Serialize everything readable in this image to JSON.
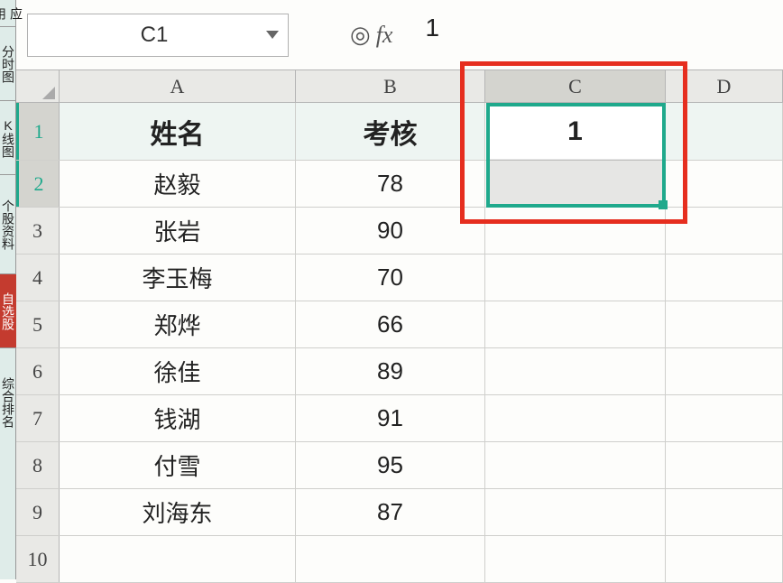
{
  "sidebar": {
    "items": [
      {
        "label": "应用",
        "active": false
      },
      {
        "label": "分时图",
        "active": false
      },
      {
        "label": "K线图",
        "active": false
      },
      {
        "label": "个股资料",
        "active": false
      },
      {
        "label": "自选股",
        "active": true
      },
      {
        "label": "综合排名",
        "active": false
      }
    ]
  },
  "formula_bar": {
    "name_box": "C1",
    "fx_label": "fx",
    "value": "1"
  },
  "columns": [
    "A",
    "B",
    "C",
    "D"
  ],
  "rows": [
    {
      "n": 1,
      "A": "姓名",
      "B": "考核",
      "C": "1",
      "is_header": true
    },
    {
      "n": 2,
      "A": "赵毅",
      "B": "78",
      "C": ""
    },
    {
      "n": 3,
      "A": "张岩",
      "B": "90",
      "C": ""
    },
    {
      "n": 4,
      "A": "李玉梅",
      "B": "70",
      "C": ""
    },
    {
      "n": 5,
      "A": "郑烨",
      "B": "66",
      "C": ""
    },
    {
      "n": 6,
      "A": "徐佳",
      "B": "89",
      "C": ""
    },
    {
      "n": 7,
      "A": "钱湖",
      "B": "91",
      "C": ""
    },
    {
      "n": 8,
      "A": "付雪",
      "B": "95",
      "C": ""
    },
    {
      "n": 9,
      "A": "刘海东",
      "B": "87",
      "C": ""
    },
    {
      "n": 10,
      "A": "",
      "B": "",
      "C": ""
    }
  ],
  "selection": {
    "active_cell": "C1",
    "range": "C1:C2"
  }
}
